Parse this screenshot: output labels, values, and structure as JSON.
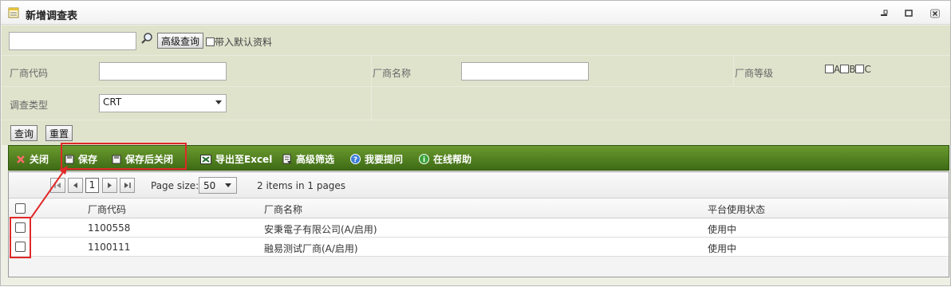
{
  "window": {
    "title": "新增调查表"
  },
  "search": {
    "keyword_value": "",
    "advanced_query_label": "高级查询",
    "default_data_label": "带入默认资料",
    "vendor_code_label": "厂商代码",
    "vendor_code_value": "",
    "vendor_name_label": "厂商名称",
    "vendor_name_value": "",
    "vendor_level_label": "厂商等级",
    "level_options": [
      "A",
      "B",
      "C"
    ],
    "survey_type_label": "调查类型",
    "survey_type_value": "CRT",
    "query_button": "查询",
    "reset_button": "重置"
  },
  "toolbar": {
    "close": "关闭",
    "save": "保存",
    "save_close": "保存后关闭",
    "export_excel": "导出至Excel",
    "advanced_filter": "高级筛选",
    "ask_question": "我要提问",
    "online_help": "在线帮助"
  },
  "pager": {
    "current_page": "1",
    "page_size_label": "Page size:",
    "page_size_value": "50",
    "info": "2 items in 1 pages"
  },
  "grid": {
    "columns": [
      "厂商代码",
      "厂商名称",
      "平台使用状态"
    ],
    "rows": [
      {
        "code": "1100558",
        "name": "安秉電子有限公司(A/启用)",
        "status": "使用中"
      },
      {
        "code": "1100111",
        "name": "融易测试厂商(A/启用)",
        "status": "使用中"
      }
    ]
  },
  "colors": {
    "toolbar_green": "#4e7d1f",
    "search_bg": "#dfe3cc",
    "annotation_red": "#e12828"
  }
}
